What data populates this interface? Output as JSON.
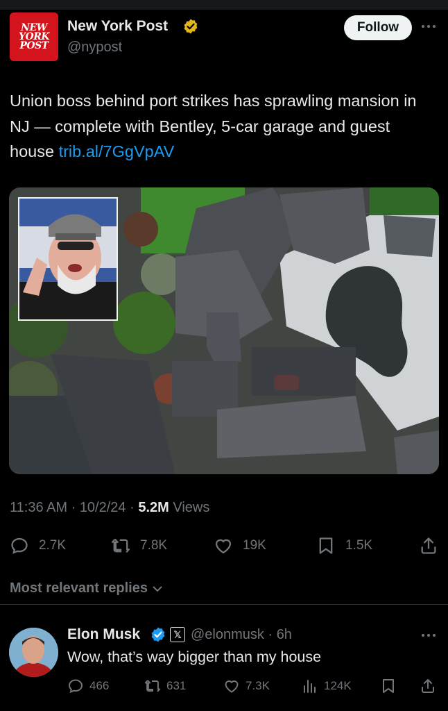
{
  "post": {
    "author": {
      "logo_text": [
        "NEW",
        "YORK",
        "POST"
      ],
      "name": "New York Post",
      "handle": "@nypost",
      "verified_color": "#e2b719"
    },
    "follow_label": "Follow",
    "text": "Union boss behind port strikes has sprawling mansion in NJ — complete with Bentley, 5-car garage and guest house ",
    "link": "trib.al/7GgVpAV",
    "meta": {
      "time": "11:36 AM",
      "sep1": " · ",
      "date": "10/2/24",
      "sep2": " · ",
      "views_count": "5.2M",
      "views_label": " Views"
    },
    "actions": {
      "replies": "2.7K",
      "reposts": "7.8K",
      "likes": "19K",
      "bookmarks": "1.5K"
    }
  },
  "replies_header": "Most relevant replies",
  "reply": {
    "name": "Elon Musk",
    "verified_color": "#1d9bf0",
    "badge": "𝕏",
    "handle": "@elonmusk",
    "sep": " · ",
    "time": "6h",
    "text": "Wow, that’s way bigger than my house",
    "actions": {
      "replies": "466",
      "reposts": "631",
      "likes": "7.3K",
      "views": "124K"
    }
  },
  "colors": {
    "background": "#000000",
    "text": "#e7e9ea",
    "muted": "#71767b",
    "link": "#1d9bf0",
    "logo_red": "#d4141c"
  }
}
